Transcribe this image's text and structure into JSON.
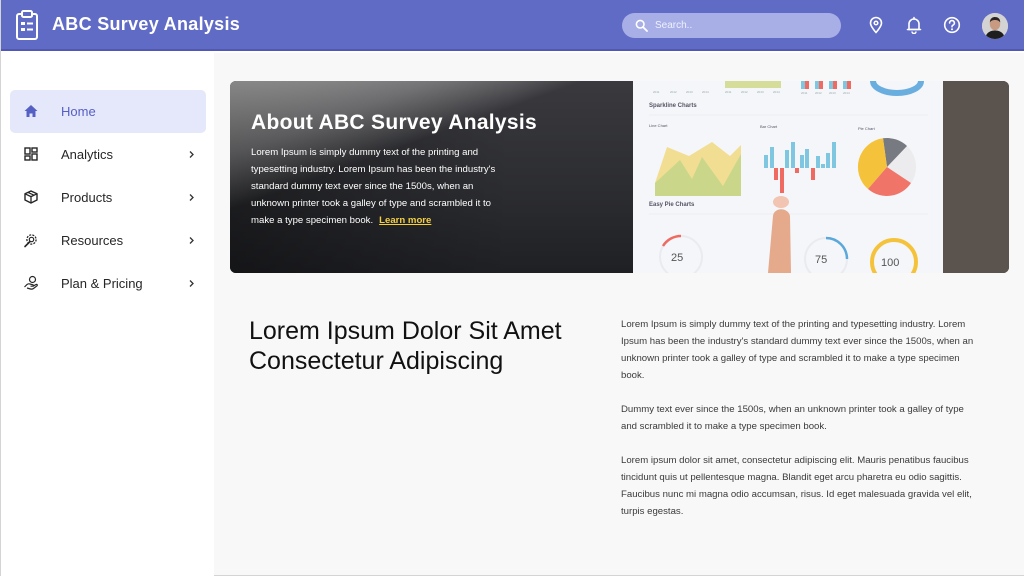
{
  "header": {
    "app_title": "ABC Survey Analysis",
    "logo_icon": "clipboard-list-icon",
    "search": {
      "placeholder": "Search..",
      "value": "",
      "icon": "search-icon"
    },
    "icons": [
      "map-pin-icon",
      "bell-icon",
      "help-circle-icon"
    ],
    "avatar_alt": "User avatar"
  },
  "colors": {
    "brand": "#606bc6",
    "active_nav_bg": "#e5e7fb",
    "active_nav_text": "#5560c4",
    "link_accent": "#f4d03f"
  },
  "sidebar": {
    "items": [
      {
        "label": "Home",
        "icon": "home-icon",
        "active": true,
        "has_submenu": false
      },
      {
        "label": "Analytics",
        "icon": "dashboard-grid-icon",
        "active": false,
        "has_submenu": true
      },
      {
        "label": "Products",
        "icon": "box-icon",
        "active": false,
        "has_submenu": true
      },
      {
        "label": "Resources",
        "icon": "gear-wrench-icon",
        "active": false,
        "has_submenu": true
      },
      {
        "label": "Plan & Pricing",
        "icon": "hand-coin-icon",
        "active": false,
        "has_submenu": true
      }
    ]
  },
  "hero": {
    "title": "About ABC Survey Analysis",
    "text": "Lorem Ipsum is simply dummy text of the printing and typesetting industry. Lorem Ipsum has been the industry's standard dummy text ever since the 1500s, when an unknown printer took a galley of type and scrambled it to make a type specimen book.",
    "link_label": "Learn more",
    "image_labels": {
      "sparkline": "Sparkline Charts",
      "line": "Line Chart",
      "bar": "Bar Chart",
      "pie": "Pie Chart",
      "easy_pie": "Easy Pie Charts",
      "gauges": [
        "25",
        "75",
        "100"
      ],
      "percent": "%"
    }
  },
  "content": {
    "headline": "Lorem Ipsum Dolor Sit Amet Consectetur Adipiscing",
    "paragraphs": [
      "Lorem Ipsum is simply dummy text of the printing and typesetting industry. Lorem Ipsum has been the industry's standard dummy text ever since the 1500s, when an unknown printer took a galley of type and scrambled it to make a type specimen book.",
      "Dummy text ever since the 1500s, when an unknown printer took a galley of type and scrambled it to make a type specimen book.",
      "Lorem ipsum dolor sit amet, consectetur adipiscing elit. Mauris penatibus faucibus tincidunt quis ut pellentesque magna. Blandit eget arcu pharetra eu odio sagittis. Faucibus nunc mi magna odio accumsan, risus. Id eget malesuada gravida vel elit, turpis egestas."
    ]
  }
}
